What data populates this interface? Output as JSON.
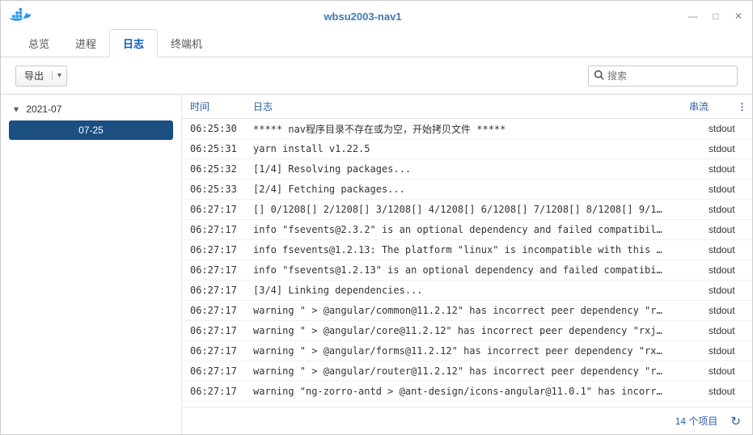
{
  "window": {
    "title": "wbsu2003-nav1"
  },
  "tabs": [
    {
      "label": "总览"
    },
    {
      "label": "进程"
    },
    {
      "label": "日志",
      "active": true
    },
    {
      "label": "终端机"
    }
  ],
  "toolbar": {
    "export_label": "导出",
    "search_placeholder": "搜索"
  },
  "sidebar": {
    "month": "2021-07",
    "days": [
      {
        "label": "07-25",
        "selected": true
      }
    ]
  },
  "grid": {
    "columns": {
      "time": "时间",
      "log": "日志",
      "stream": "串流"
    },
    "rows": [
      {
        "time": "06:25:30",
        "log": "***** nav程序目录不存在或为空，开始拷贝文件 *****",
        "stream": "stdout"
      },
      {
        "time": "06:25:31",
        "log": "yarn install v1.22.5",
        "stream": "stdout"
      },
      {
        "time": "06:25:32",
        "log": "[1/4] Resolving packages...",
        "stream": "stdout"
      },
      {
        "time": "06:25:33",
        "log": "[2/4] Fetching packages...",
        "stream": "stdout"
      },
      {
        "time": "06:27:17",
        "log": "[] 0/1208[] 2/1208[] 3/1208[] 4/1208[] 6/1208[] 7/1208[] 8/1208[] 9/1…",
        "stream": "stdout"
      },
      {
        "time": "06:27:17",
        "log": "info \"fsevents@2.3.2\" is an optional dependency and failed compatibil…",
        "stream": "stdout"
      },
      {
        "time": "06:27:17",
        "log": "info fsevents@1.2.13: The platform \"linux\" is incompatible with this …",
        "stream": "stdout"
      },
      {
        "time": "06:27:17",
        "log": "info \"fsevents@1.2.13\" is an optional dependency and failed compatibi…",
        "stream": "stdout"
      },
      {
        "time": "06:27:17",
        "log": "[3/4] Linking dependencies...",
        "stream": "stdout"
      },
      {
        "time": "06:27:17",
        "log": "warning \" > @angular/common@11.2.12\" has incorrect peer dependency \"r…",
        "stream": "stdout"
      },
      {
        "time": "06:27:17",
        "log": "warning \" > @angular/core@11.2.12\" has incorrect peer dependency \"rxj…",
        "stream": "stdout"
      },
      {
        "time": "06:27:17",
        "log": "warning \" > @angular/forms@11.2.12\" has incorrect peer dependency \"rx…",
        "stream": "stdout"
      },
      {
        "time": "06:27:17",
        "log": "warning \" > @angular/router@11.2.12\" has incorrect peer dependency \"r…",
        "stream": "stdout"
      },
      {
        "time": "06:27:17",
        "log": "warning \"ng-zorro-antd > @ant-design/icons-angular@11.0.1\" has incorr…",
        "stream": "stdout"
      }
    ]
  },
  "footer": {
    "count_label": "14 个项目"
  }
}
